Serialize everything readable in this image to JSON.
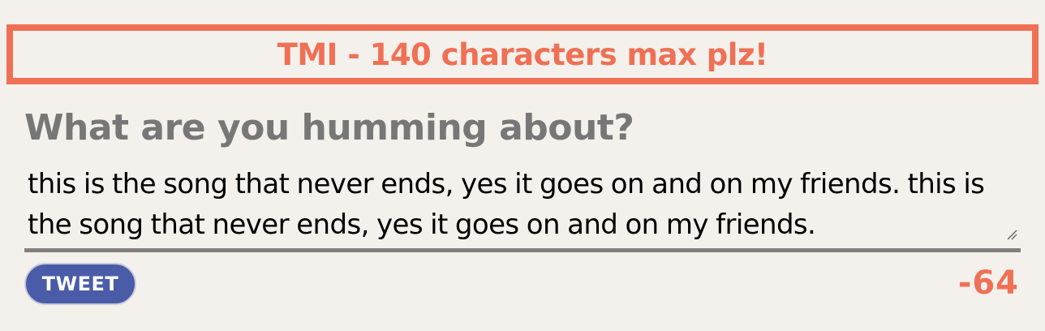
{
  "banner": {
    "error_text": "TMI - 140 characters max plz!"
  },
  "compose": {
    "label": "What are you humming about?",
    "textarea_value": "this is the song that never ends, yes it goes on and on my friends. this is the song that never ends, yes it goes on and on my friends.",
    "submit_label": "TWEET",
    "char_count": "-64"
  },
  "colors": {
    "accent_error": "#ef7055",
    "button": "#4a5ca8",
    "background": "#f4f0eb",
    "label": "#777777"
  }
}
